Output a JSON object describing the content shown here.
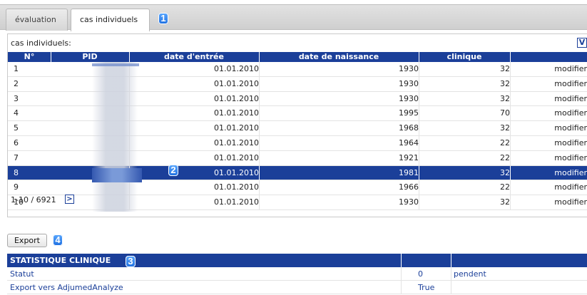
{
  "tabs": [
    {
      "label": "évaluation",
      "active": false
    },
    {
      "label": "cas individuels",
      "active": true
    }
  ],
  "markers": [
    "1",
    "2",
    "3",
    "4"
  ],
  "panel": {
    "title": "cas individuels:",
    "v_badge": "V",
    "columns": [
      "N°",
      "PID",
      "date d'entrée",
      "date de naissance",
      "clinique"
    ],
    "rows": [
      {
        "num": "1",
        "date": "01.01.2010",
        "year": "1930",
        "clinic": "32",
        "action": "modifier"
      },
      {
        "num": "2",
        "date": "01.01.2010",
        "year": "1930",
        "clinic": "32",
        "action": "modifier"
      },
      {
        "num": "3",
        "date": "01.01.2010",
        "year": "1930",
        "clinic": "32",
        "action": "modifier"
      },
      {
        "num": "4",
        "date": "01.01.2010",
        "year": "1995",
        "clinic": "70",
        "action": "modifier"
      },
      {
        "num": "5",
        "date": "01.01.2010",
        "year": "1968",
        "clinic": "32",
        "action": "modifier"
      },
      {
        "num": "6",
        "date": "01.01.2010",
        "year": "1964",
        "clinic": "22",
        "action": "modifier"
      },
      {
        "num": "7",
        "date": "01.01.2010",
        "year": "1921",
        "clinic": "22",
        "action": "modifier"
      },
      {
        "num": "8",
        "date": "01.01.2010",
        "year": "1981",
        "clinic": "32",
        "action": "modifier"
      },
      {
        "num": "9",
        "date": "01.01.2010",
        "year": "1966",
        "clinic": "22",
        "action": "modifier"
      },
      {
        "num": "10",
        "date": "01.01.2010",
        "year": "1930",
        "clinic": "32",
        "action": "modifier"
      }
    ],
    "selected_row": 8,
    "pager_text": "1-10 / 6921",
    "pager_next": ">"
  },
  "export_label": "Export",
  "stats": {
    "header": "STATISTIQUE CLINIQUE",
    "rows": [
      {
        "label": "Statut",
        "value": "0",
        "extra": "pendent"
      },
      {
        "label": "Export vers AdjumedAnalyze",
        "value": "True",
        "extra": ""
      }
    ]
  },
  "colors": {
    "accent": "#1b3f99",
    "marker": "#2f86f0"
  }
}
